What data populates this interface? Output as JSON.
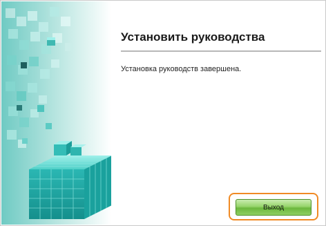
{
  "dialog": {
    "title": "Установить руководства",
    "message": "Установка руководств завершена.",
    "exit_button_label": "Выход",
    "accent_color": "#f08a24",
    "button_color": "#7cc44c",
    "art_color": "#2bb7b3"
  }
}
